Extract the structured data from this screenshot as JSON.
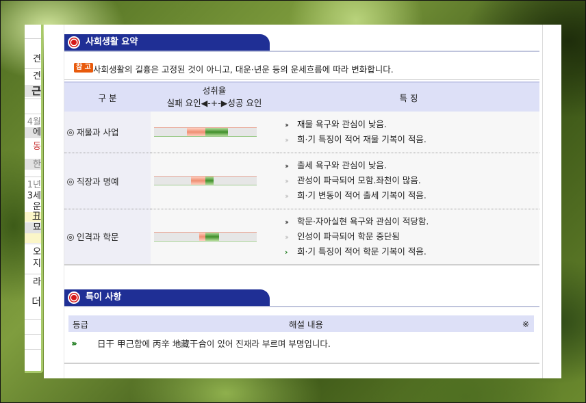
{
  "left_panel": {
    "cells": [
      "견",
      "견",
      "근",
      "4월",
      "에",
      "동",
      "한",
      "1년",
      "3세",
      "운",
      "丑",
      "묘",
      "오",
      "지",
      "라",
      "더"
    ]
  },
  "summary": {
    "section_title": "사회생활 요약",
    "note_badge": "참 고",
    "note_text": "사회생활의 길흉은 고정된 것이 아니고, 대운·년운 등의 운세흐름에 따라 변화합니다.",
    "headers": {
      "category": "구 분",
      "score_title": "성취율",
      "score_scale": "실패 요인◀-+-▶성공 요인",
      "features": "특 징"
    },
    "rows": [
      {
        "category": "재물과 사업",
        "neg_percent": 18,
        "pos_percent": 22,
        "lines": [
          {
            "arrow": "dark",
            "text": "재물 욕구와 관심이 낮음."
          },
          {
            "arrow": "light",
            "text": "희·기 특징이 적어 재물 기복이 적음."
          }
        ]
      },
      {
        "category": "직장과 명예",
        "neg_percent": 14,
        "pos_percent": 8,
        "lines": [
          {
            "arrow": "dark",
            "text": "출세 욕구와 관심이 낮음."
          },
          {
            "arrow": "light",
            "text": "관성이 파극되어 모함.좌천이 많음."
          },
          {
            "arrow": "light",
            "text": "희·기 변동이 적어 출세 기복이 적음."
          }
        ]
      },
      {
        "category": "인격과 학문",
        "neg_percent": 6,
        "pos_percent": 13,
        "lines": [
          {
            "arrow": "dark",
            "text": "학문·자아실현 욕구와 관심이 적당함."
          },
          {
            "arrow": "light",
            "text": "인성이 파극되어 학문 중단됨"
          },
          {
            "arrow": "green",
            "text": "희·기 특징이 적어 학문 기복이 적음."
          }
        ]
      }
    ]
  },
  "special": {
    "section_title": "특이 사항",
    "headers": {
      "grade": "등급",
      "content": "해설 내용",
      "mark": "※"
    },
    "rows": [
      {
        "text": "日干 甲己합에 丙辛 地藏干合이 있어 진재라 부르며 부명입니다."
      }
    ]
  },
  "colors": {
    "section_tab": "#1f2f95",
    "header_bg": "#dde0f7",
    "badge": "#e85a0c",
    "success_bar": "#3f8f2a",
    "failure_bar": "#ef8f72"
  }
}
